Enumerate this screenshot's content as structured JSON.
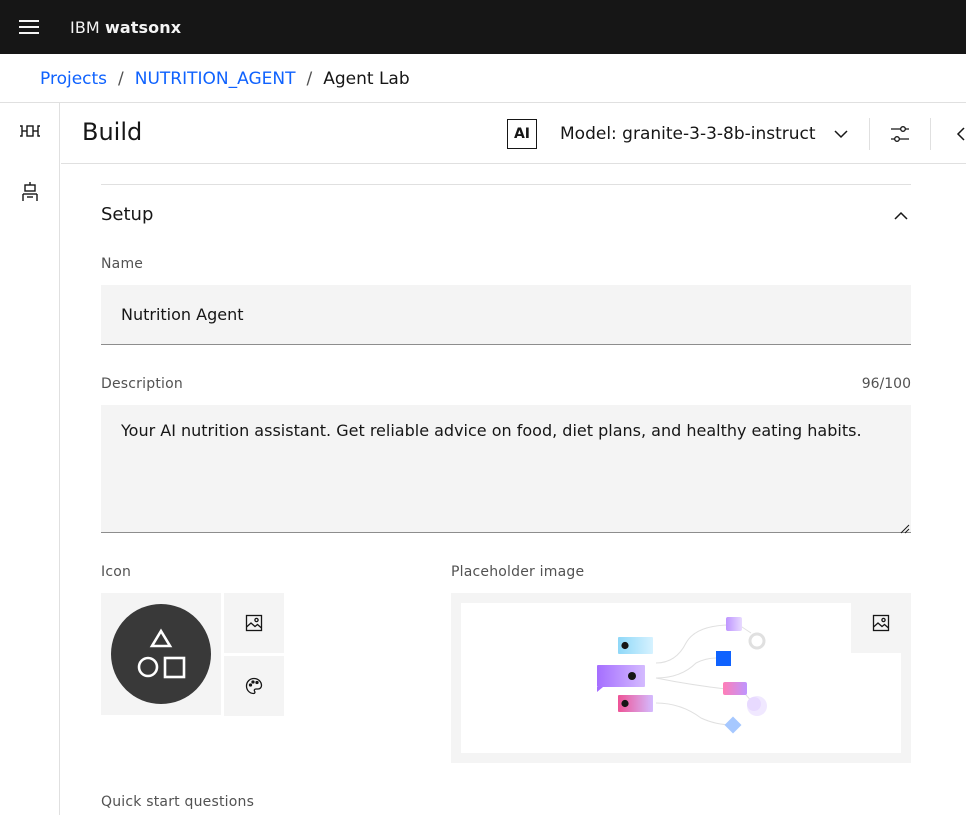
{
  "header": {
    "menu_icon": "hamburger-menu-icon",
    "brand_prefix": "IBM",
    "brand_name": "watsonx"
  },
  "breadcrumb": {
    "items": [
      "Projects",
      "NUTRITION_AGENT",
      "Agent Lab"
    ],
    "separator": "/"
  },
  "rail": {
    "items": [
      {
        "icon": "flow-icon"
      },
      {
        "icon": "agent-icon"
      }
    ]
  },
  "build": {
    "title": "Build",
    "ai_badge": "AI",
    "model_label": "Model: granite-3-3-8b-instruct",
    "icons": [
      "chevron-down-icon",
      "settings-adjust-icon",
      "chevron-left-icon"
    ]
  },
  "setup": {
    "title": "Setup",
    "name_label": "Name",
    "name_value": "Nutrition Agent",
    "description_label": "Description",
    "description_count": "96/100",
    "description_value": "Your AI nutrition assistant. Get reliable advice on food, diet plans, and healthy eating habits.",
    "icon_label": "Icon",
    "placeholder_image_label": "Placeholder image",
    "quick_start_label": "Quick start questions"
  },
  "colors": {
    "header_bg": "#161616",
    "link": "#0f62fe",
    "field_bg": "#f4f4f4",
    "icon_circle": "#393939"
  }
}
